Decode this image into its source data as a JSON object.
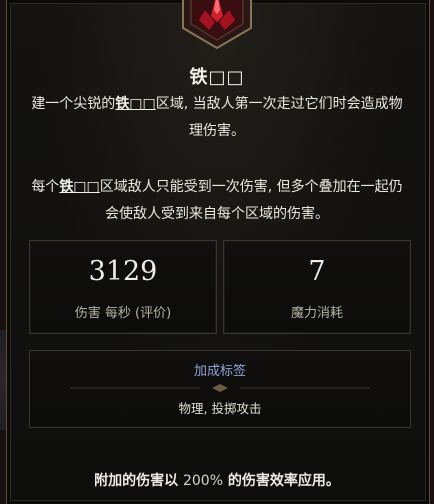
{
  "skill": {
    "title": "铁□□",
    "icon": "iron-spike-gem-icon",
    "description_1": {
      "before": "建一个尖锐的",
      "keyword": "铁□□",
      "after": "区域, 当敌人第一次走过它们时会造成物理伤害。"
    },
    "description_2": {
      "before": "每个",
      "keyword": "铁□□",
      "after": "区域敌人只能受到一次伤害, 但多个叠加在一起仍会使敌人受到来自每个区域的伤害。"
    }
  },
  "stats": [
    {
      "value": "3129",
      "label": "伤害 每秒 (评价)"
    },
    {
      "value": "7",
      "label": "魔力消耗"
    }
  ],
  "tags": {
    "heading": "加成标签",
    "list": "物理, 投掷攻击"
  },
  "footer": {
    "before": "附加的伤害以",
    "percent": "200%",
    "after": "的伤害效率应用。"
  },
  "colors": {
    "background": "#0b0b0b",
    "frame_gold": "#6b5b3f",
    "tag_heading": "#8fa6d6",
    "gem_red": "#b3121f"
  }
}
